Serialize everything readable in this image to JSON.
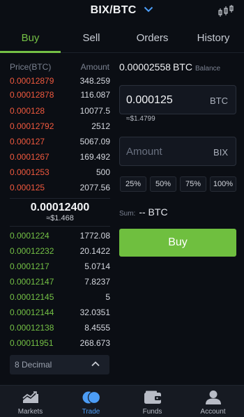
{
  "header": {
    "pair": "BIX/BTC"
  },
  "tabs": [
    {
      "label": "Buy"
    },
    {
      "label": "Sell"
    },
    {
      "label": "Orders"
    },
    {
      "label": "History"
    }
  ],
  "orderbook": {
    "price_header": "Price(BTC)",
    "amount_header": "Amount",
    "asks": [
      {
        "price": "0.00012879",
        "amount": "348.259"
      },
      {
        "price": "0.00012878",
        "amount": "116.087"
      },
      {
        "price": "0.000128",
        "amount": "10077.5"
      },
      {
        "price": "0.00012792",
        "amount": "2512"
      },
      {
        "price": "0.000127",
        "amount": "5067.09"
      },
      {
        "price": "0.0001267",
        "amount": "169.492"
      },
      {
        "price": "0.0001253",
        "amount": "500"
      },
      {
        "price": "0.000125",
        "amount": "2077.56"
      }
    ],
    "last_price": "0.00012400",
    "last_price_fiat": "≈$1.468",
    "bids": [
      {
        "price": "0.0001224",
        "amount": "1772.08"
      },
      {
        "price": "0.00012232",
        "amount": "20.1422"
      },
      {
        "price": "0.0001217",
        "amount": "5.0714"
      },
      {
        "price": "0.00012147",
        "amount": "7.8237"
      },
      {
        "price": "0.00012145",
        "amount": "5"
      },
      {
        "price": "0.00012144",
        "amount": "32.0351"
      },
      {
        "price": "0.00012138",
        "amount": "8.4555"
      },
      {
        "price": "0.00011951",
        "amount": "268.673"
      }
    ],
    "decimal_label": "8 Decimal"
  },
  "form": {
    "balance_value": "0.00002558",
    "balance_currency": "BTC",
    "balance_label": "Balance",
    "price_value": "0.000125",
    "price_unit": "BTC",
    "price_fiat": "≈$1.4799",
    "amount_placeholder": "Amount",
    "amount_unit": "BIX",
    "percent_buttons": [
      "25%",
      "50%",
      "75%",
      "100%"
    ],
    "sum_label": "Sum:",
    "sum_value": "-- BTC",
    "buy_label": "Buy"
  },
  "bottom_nav": [
    {
      "label": "Markets",
      "icon": "markets-icon"
    },
    {
      "label": "Trade",
      "icon": "trade-icon"
    },
    {
      "label": "Funds",
      "icon": "funds-icon"
    },
    {
      "label": "Account",
      "icon": "account-icon"
    }
  ],
  "colors": {
    "accent_green": "#74c045",
    "ask_red": "#f1593e",
    "nav_active_blue": "#4c9df6",
    "background": "#0b0e14"
  }
}
